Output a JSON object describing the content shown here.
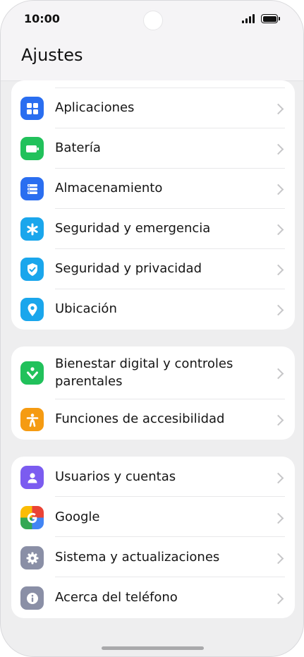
{
  "status_bar": {
    "time": "10:00"
  },
  "header": {
    "title": "Ajustes"
  },
  "groups": [
    {
      "items": [
        {
          "label": "Aplicaciones",
          "icon": "apps-icon",
          "color": "#2a6ef0"
        },
        {
          "label": "Batería",
          "icon": "battery-icon",
          "color": "#21c15b"
        },
        {
          "label": "Almacenamiento",
          "icon": "storage-icon",
          "color": "#2a6ef0"
        },
        {
          "label": "Seguridad y emergencia",
          "icon": "asterisk-icon",
          "color": "#1aa6ec"
        },
        {
          "label": "Seguridad y privacidad",
          "icon": "shield-icon",
          "color": "#1aa6ec"
        },
        {
          "label": "Ubicación",
          "icon": "location-pin-icon",
          "color": "#1aa6ec"
        }
      ]
    },
    {
      "items": [
        {
          "label": "Bienestar digital y controles",
          "label_line2": "parentales",
          "icon": "digital-wellbeing-icon",
          "color": "#21c15b"
        },
        {
          "label": "Funciones de accesibilidad",
          "icon": "accessibility-icon",
          "color": "#f59b12"
        }
      ]
    },
    {
      "items": [
        {
          "label": "Usuarios y cuentas",
          "icon": "user-icon",
          "color": "#7b5cf0"
        },
        {
          "label": "Google",
          "icon": "google-icon",
          "color": "#4285f4"
        },
        {
          "label": "Sistema y actualizaciones",
          "icon": "gear-icon",
          "color": "#8a8fa6"
        },
        {
          "label": "Acerca del teléfono",
          "icon": "info-icon",
          "color": "#8a8fa6"
        }
      ]
    }
  ]
}
